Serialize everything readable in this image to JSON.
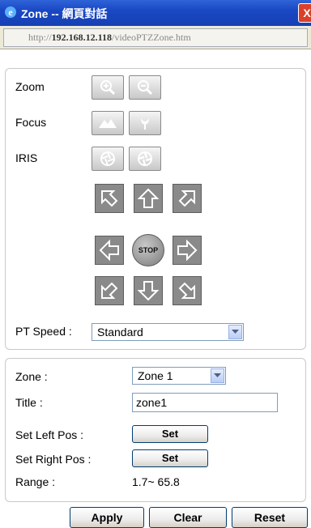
{
  "window": {
    "title": "Zone -- 網頁對話",
    "close_label": "X"
  },
  "address": {
    "prefix": "http://",
    "host": "192.168.12.118",
    "path": "/videoPTZZone.htm"
  },
  "ptz": {
    "zoom_label": "Zoom",
    "focus_label": "Focus",
    "iris_label": "IRIS",
    "stop_label": "STOP",
    "speed_label": "PT Speed :",
    "speed_value": "Standard"
  },
  "zone": {
    "zone_label": "Zone :",
    "zone_value": "Zone 1",
    "title_label": "Title :",
    "title_value": "zone1",
    "left_label": "Set Left Pos :",
    "right_label": "Set Right Pos :",
    "set_label": "Set",
    "range_label": "Range :",
    "range_value": "1.7~ 65.8"
  },
  "actions": {
    "apply": "Apply",
    "clear": "Clear",
    "reset": "Reset"
  }
}
